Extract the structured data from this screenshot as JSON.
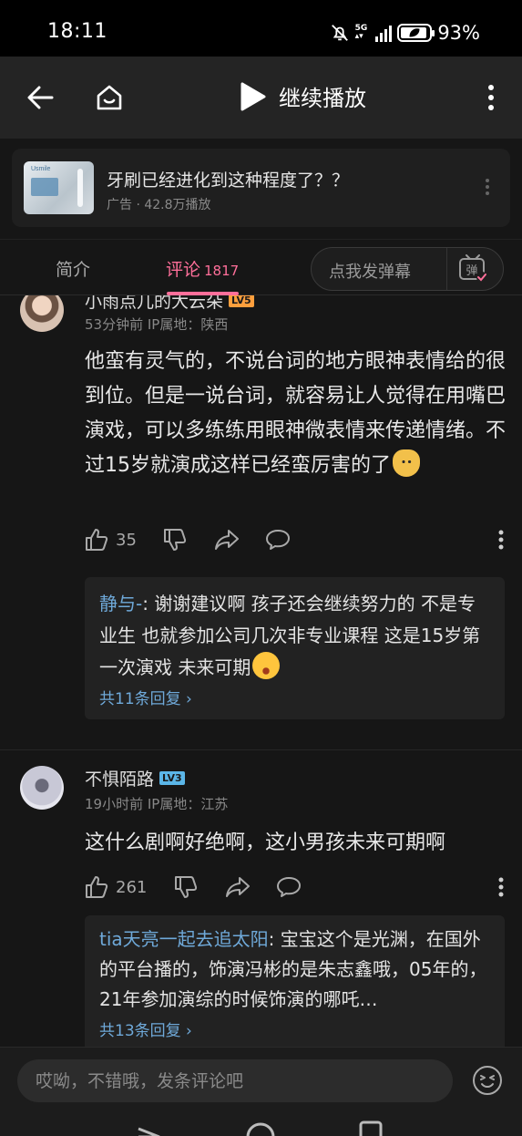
{
  "status_bar": {
    "time": "18:11",
    "network": "5G",
    "battery": "93%",
    "battery_level": 0.93
  },
  "header": {
    "play_label": "继续播放"
  },
  "ad": {
    "title": "牙刷已经进化到这种程度了？？",
    "meta": "广告 · 42.8万播放",
    "thumb_text": "Usmile"
  },
  "tabs": {
    "intro": "简介",
    "comments": "评论",
    "comments_count": "1817",
    "danmaku": "点我发弹幕",
    "danmaku_icon_char": "弹"
  },
  "comments": [
    {
      "username": "小雨点儿的大云朵",
      "level": "LV5",
      "meta": "53分钟前 IP属地：陕西",
      "text": "他蛮有灵气的，不说台词的地方眼神表情给的很到位。但是一说台词，就容易让人觉得在用嘴巴演戏，可以多练练用眼神微表情来传递情绪。不过15岁就演成这样已经蛮厉害的了",
      "likes": "35",
      "reply": {
        "user": "静与-",
        "text": ": 谢谢建议啊 孩子还会继续努力的 不是专业生 也就参加公司几次非专业课程  这是15岁第一次演戏  未来可期",
        "more": "共11条回复 ›"
      }
    },
    {
      "username": "不惧陌路",
      "level": "LV3",
      "meta": "19小时前 IP属地：江苏",
      "text": "这什么剧啊好绝啊，这小男孩未来可期啊",
      "likes": "261",
      "reply": {
        "user": "tia天亮一起去追太阳",
        "text": ": 宝宝这个是光渊，在国外的平台播的，饰演冯彬的是朱志鑫哦，05年的，21年参加演综的时候饰演的哪吒…",
        "more": "共13条回复 ›"
      }
    }
  ],
  "bottom": {
    "placeholder": "哎呦，不错哦，发条评论吧"
  },
  "colors": {
    "accent": "#ff6f9a",
    "link": "#6fa9d9",
    "bg": "#161616"
  }
}
